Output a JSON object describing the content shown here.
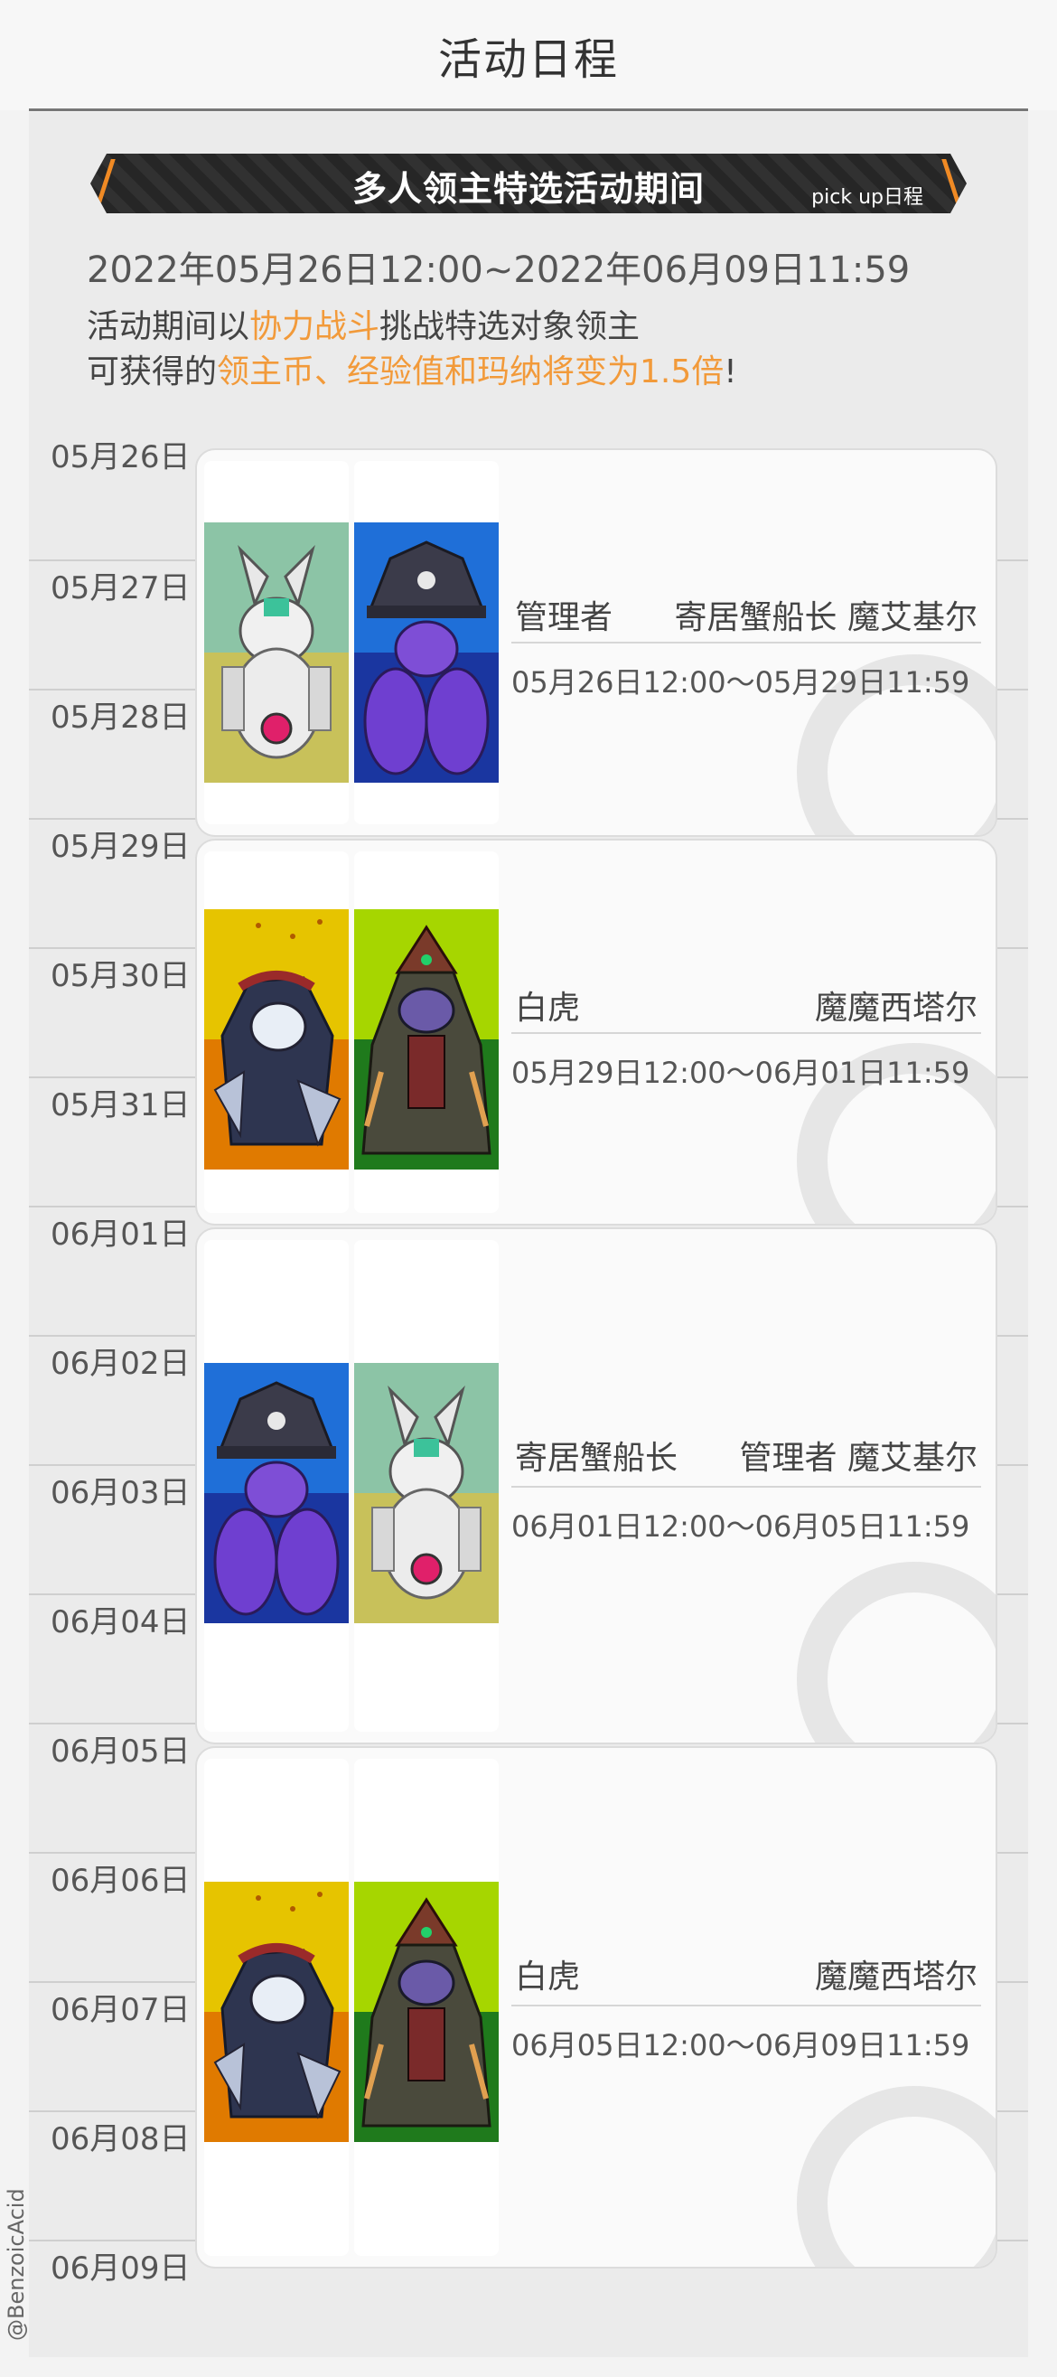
{
  "header": {
    "title": "活动日程"
  },
  "banner": {
    "title": "多人领主特选活动期间",
    "subtitle": "pick up日程"
  },
  "period": "2022年05月26日12:00~2022年06月09日11:59",
  "description": {
    "line1_prefix": "活动期间以",
    "line1_highlight": "协力战斗",
    "line1_suffix": "挑战特选对象领主",
    "line2_prefix": "可获得的",
    "line2_highlight": "领主币、经验值和玛纳将变为1.5倍",
    "line2_suffix": "!"
  },
  "dates": [
    "05月26日",
    "05月27日",
    "05月28日",
    "05月29日",
    "05月30日",
    "05月31日",
    "06月01日",
    "06月02日",
    "06月03日",
    "06月04日",
    "06月05日",
    "06月06日",
    "06月07日",
    "06月08日",
    "06月09日"
  ],
  "cards": [
    {
      "boss_left": "管理者",
      "boss_right": "寄居蟹船长 魔艾基尔",
      "time": "05月26日12:00～05月29日11:59",
      "portraits": [
        "white-beast-portrait",
        "pirate-crab-portrait"
      ]
    },
    {
      "boss_left": "白虎",
      "boss_right": "魔魔西塔尔",
      "time": "05月29日12:00～06月01日11:59",
      "portraits": [
        "white-tiger-portrait",
        "demon-lord-portrait"
      ]
    },
    {
      "boss_left": "寄居蟹船长",
      "boss_right": "管理者 魔艾基尔",
      "time": "06月01日12:00～06月05日11:59",
      "portraits": [
        "pirate-crab-portrait",
        "white-beast-portrait"
      ]
    },
    {
      "boss_left": "白虎",
      "boss_right": "魔魔西塔尔",
      "time": "06月05日12:00～06月09日11:59",
      "portraits": [
        "white-tiger-portrait",
        "demon-lord-portrait"
      ]
    }
  ],
  "credit": "@BenzoicAcid",
  "colors": {
    "accent": "#f29a3a",
    "banner_bg": "#262626"
  }
}
